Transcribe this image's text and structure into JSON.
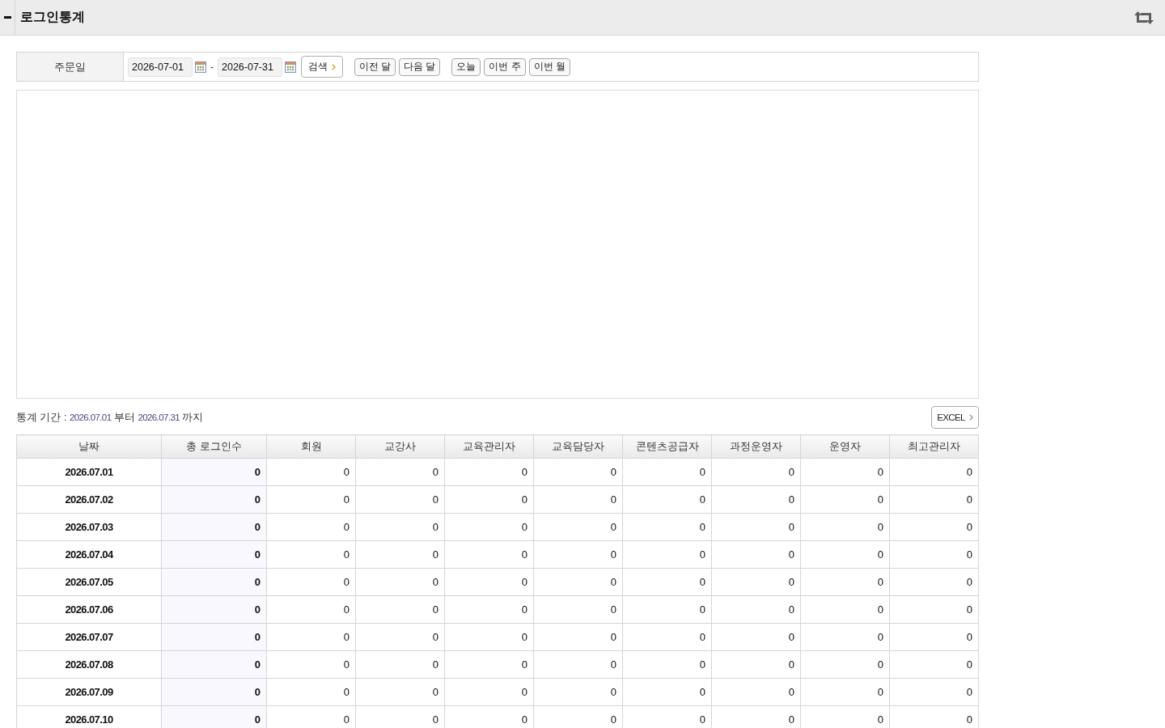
{
  "header": {
    "title": "로그인통계"
  },
  "search_form": {
    "label": "주문일",
    "start_date": "2026-07-01",
    "separator": "-",
    "end_date": "2026-07-31",
    "search_button": "검색",
    "month_buttons": [
      "이전 달",
      "다음 달"
    ],
    "range_buttons": [
      "오늘",
      "이번 주",
      "이번 월"
    ]
  },
  "period": {
    "label": "통계 기간 :",
    "start": "2026.07.01",
    "from_word": "부터",
    "end": "2026.07.31",
    "to_word": "까지"
  },
  "excel_button": "EXCEL",
  "table": {
    "columns": [
      "날짜",
      "총 로그인수",
      "회원",
      "교강사",
      "교육관리자",
      "교육담당자",
      "콘텐츠공급자",
      "과정운영자",
      "운영자",
      "최고관리자"
    ],
    "rows": [
      {
        "date": "2026.07.01",
        "values": [
          "0",
          "0",
          "0",
          "0",
          "0",
          "0",
          "0",
          "0",
          "0"
        ]
      },
      {
        "date": "2026.07.02",
        "values": [
          "0",
          "0",
          "0",
          "0",
          "0",
          "0",
          "0",
          "0",
          "0"
        ]
      },
      {
        "date": "2026.07.03",
        "values": [
          "0",
          "0",
          "0",
          "0",
          "0",
          "0",
          "0",
          "0",
          "0"
        ]
      },
      {
        "date": "2026.07.04",
        "values": [
          "0",
          "0",
          "0",
          "0",
          "0",
          "0",
          "0",
          "0",
          "0"
        ]
      },
      {
        "date": "2026.07.05",
        "values": [
          "0",
          "0",
          "0",
          "0",
          "0",
          "0",
          "0",
          "0",
          "0"
        ]
      },
      {
        "date": "2026.07.06",
        "values": [
          "0",
          "0",
          "0",
          "0",
          "0",
          "0",
          "0",
          "0",
          "0"
        ]
      },
      {
        "date": "2026.07.07",
        "values": [
          "0",
          "0",
          "0",
          "0",
          "0",
          "0",
          "0",
          "0",
          "0"
        ]
      },
      {
        "date": "2026.07.08",
        "values": [
          "0",
          "0",
          "0",
          "0",
          "0",
          "0",
          "0",
          "0",
          "0"
        ]
      },
      {
        "date": "2026.07.09",
        "values": [
          "0",
          "0",
          "0",
          "0",
          "0",
          "0",
          "0",
          "0",
          "0"
        ]
      },
      {
        "date": "2026.07.10",
        "values": [
          "0",
          "0",
          "0",
          "0",
          "0",
          "0",
          "0",
          "0",
          "0"
        ]
      }
    ]
  }
}
